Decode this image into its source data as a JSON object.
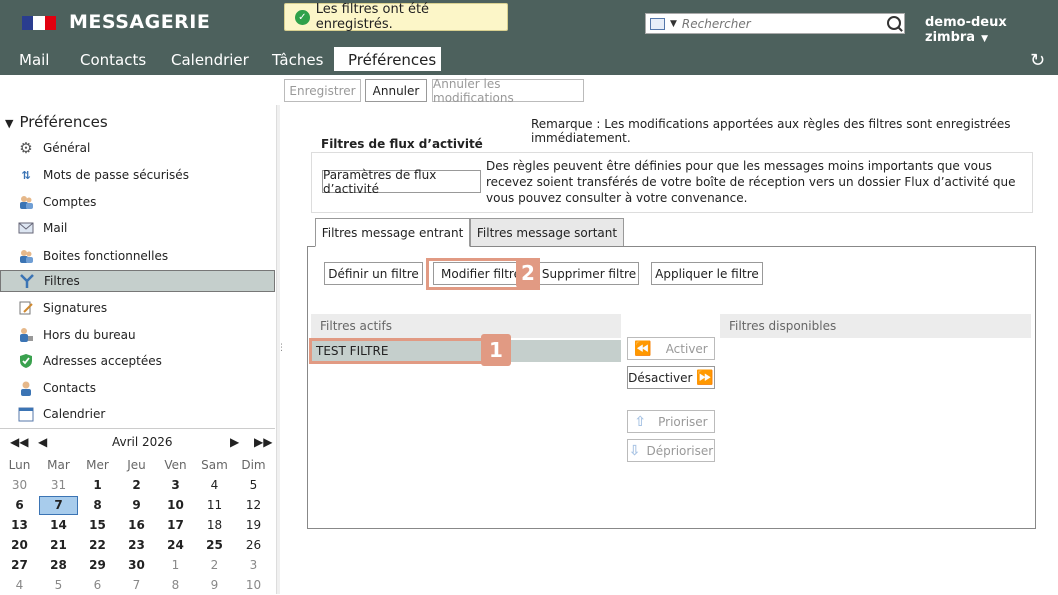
{
  "header": {
    "app_title": "MESSAGERIE",
    "toast": "Les filtres ont été enregistrés.",
    "search_placeholder": "Rechercher",
    "user": "demo-deux zimbra",
    "tabs": [
      "Mail",
      "Contacts",
      "Calendrier",
      "Tâches",
      "Préférences"
    ],
    "active_tab": "Préférences"
  },
  "toolbar": {
    "save": "Enregistrer",
    "cancel": "Annuler",
    "undo": "Annuler les modifications"
  },
  "sidebar": {
    "title": "Préférences",
    "items": [
      {
        "label": "Général",
        "icon": "gear-icon"
      },
      {
        "label": "Mots de passe sécurisés",
        "icon": "key-arrows-icon"
      },
      {
        "label": "Comptes",
        "icon": "accounts-icon"
      },
      {
        "label": "Mail",
        "icon": "mail-icon"
      },
      {
        "label": "Boites fonctionnelles",
        "icon": "mailboxes-icon"
      },
      {
        "label": "Filtres",
        "icon": "filter-icon"
      },
      {
        "label": "Signatures",
        "icon": "signature-icon"
      },
      {
        "label": "Hors du bureau",
        "icon": "out-of-office-icon"
      },
      {
        "label": "Adresses acceptées",
        "icon": "shield-check-icon"
      },
      {
        "label": "Contacts",
        "icon": "contact-icon"
      },
      {
        "label": "Calendrier",
        "icon": "calendar-icon"
      }
    ],
    "selected": "Filtres"
  },
  "calendar": {
    "month": "Avril 2026",
    "dow": [
      "Lun",
      "Mar",
      "Mer",
      "Jeu",
      "Ven",
      "Sam",
      "Dim"
    ],
    "weeks": [
      [
        "30",
        "31",
        "1",
        "2",
        "3",
        "4",
        "5"
      ],
      [
        "6",
        "7",
        "8",
        "9",
        "10",
        "11",
        "12"
      ],
      [
        "13",
        "14",
        "15",
        "16",
        "17",
        "18",
        "19"
      ],
      [
        "20",
        "21",
        "22",
        "23",
        "24",
        "25",
        "26"
      ],
      [
        "27",
        "28",
        "29",
        "30",
        "1",
        "2",
        "3"
      ],
      [
        "4",
        "5",
        "6",
        "7",
        "8",
        "9",
        "10"
      ]
    ],
    "today": "7"
  },
  "main": {
    "note": "Remarque : Les modifications apportées aux règles des filtres sont enregistrées immédiatement.",
    "activity_legend": "Filtres de flux d’activité",
    "activity_button": "Paramètres de flux d’activité",
    "activity_desc": "Des règles peuvent être définies pour que les messages moins importants que vous recevez soient transférés de votre boîte de réception vers un dossier Flux d’activité que vous pouvez consulter à votre convenance.",
    "tab_incoming": "Filtres message entrant",
    "tab_outgoing": "Filtres message sortant",
    "btn_define": "Définir un filtre",
    "btn_modify": "Modifier filtre",
    "btn_delete": "Supprimer filtre",
    "btn_apply": "Appliquer le filtre",
    "active_header": "Filtres actifs",
    "available_header": "Filtres disponibles",
    "active_filter": "TEST FILTRE",
    "btn_activate": "Activer",
    "btn_deactivate": "Désactiver",
    "btn_prioritize": "Prioriser",
    "btn_deprioritize": "Déprioriser"
  },
  "annotations": {
    "marker1": "1",
    "marker2": "2"
  }
}
